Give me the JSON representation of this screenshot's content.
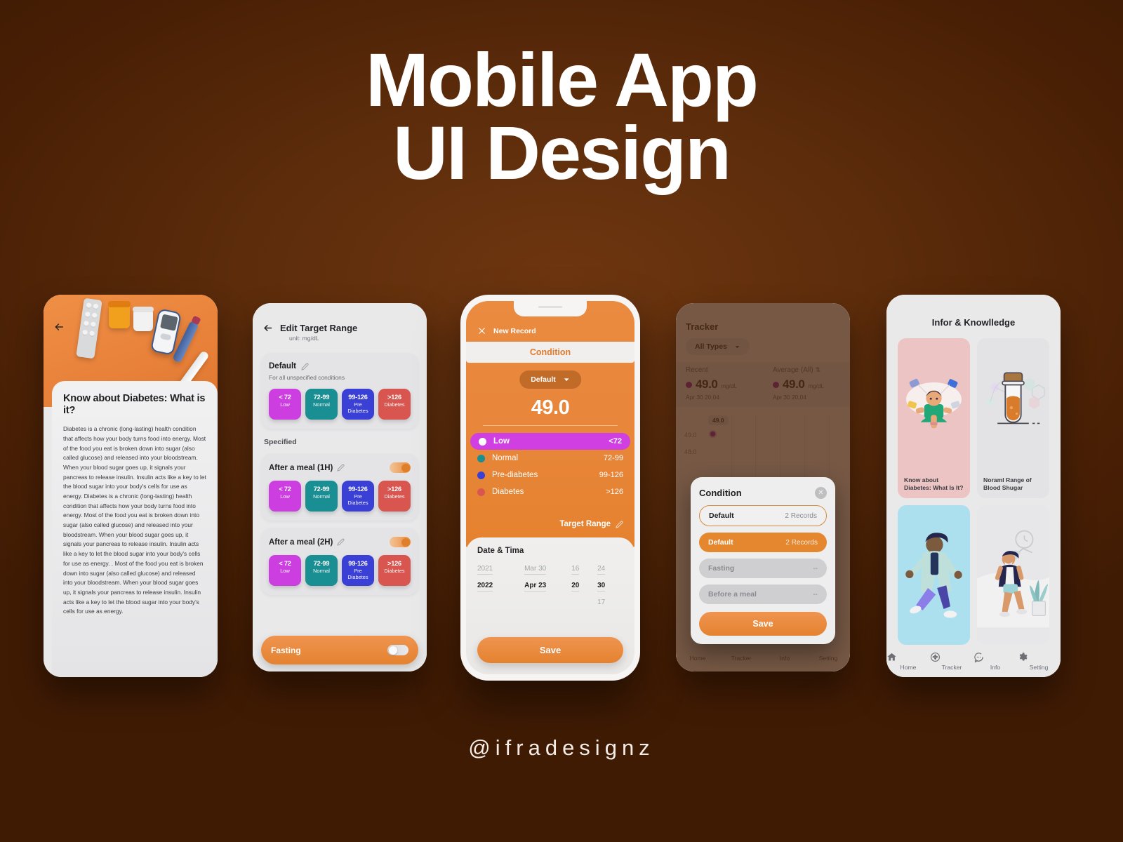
{
  "poster": {
    "title_line1": "Mobile App",
    "title_line2": "UI Design",
    "signature": "@ifradesignz",
    "bg_color": "#4a2005",
    "bg_center_color": "#6e3610",
    "accent_color": "#e4822f"
  },
  "phone1": {
    "back_icon": "back-arrow-icon",
    "article_title": "Know about Diabetes: What is it?",
    "article_body": "Diabetes is a chronic (long-lasting) health condition that affects how your body turns food into energy. Most of the food you eat is broken down into sugar (also called glucose) and released into your bloodstream. When your blood sugar goes up, it signals your pancreas to release insulin. Insulin acts like a key to let the blood sugar into your body's cells for use as energy. Diabetes is a chronic (long-lasting) health condition that affects how your body turns food into energy. Most of the food you eat is broken down into sugar (also called glucose) and released into your bloodstream. When your blood sugar goes up, it signals your pancreas to release insulin. Insulin acts like a key to let the blood sugar into your body's cells for use as energy. . Most of the food you eat is broken down into sugar (also called glucose) and released into your bloodstream. When your blood sugar goes up, it signals your pancreas to release insulin. Insulin acts like a key to let the blood sugar into your body's cells for use as energy."
  },
  "phone2": {
    "back_icon": "back-arrow-icon",
    "title": "Edit Target Range",
    "unit": "unit: mg/dL",
    "default_card": {
      "name": "Default",
      "edit_icon": "pencil-icon",
      "subtitle": "For all unspecified conditions",
      "chips": [
        {
          "value": "< 72",
          "label": "Low",
          "color": "#cc3ee0"
        },
        {
          "value": "72-99",
          "label": "Normal",
          "color": "#1a8f93"
        },
        {
          "value": "99-126",
          "label": "Pre Diabetes",
          "color": "#3a3fd6"
        },
        {
          "value": ">126",
          "label": "Diabetes",
          "color": "#d9554f"
        }
      ]
    },
    "specified_label": "Specified",
    "specified_cards": [
      {
        "name": "After a meal (1H)",
        "toggle_on": true,
        "chips": [
          {
            "value": "< 72",
            "label": "Low",
            "color": "#cc3ee0"
          },
          {
            "value": "72-99",
            "label": "Normal",
            "color": "#1a8f93"
          },
          {
            "value": "99-126",
            "label": "Pre Diabetes",
            "color": "#3a3fd6"
          },
          {
            "value": ">126",
            "label": "Diabetes",
            "color": "#d9554f"
          }
        ]
      },
      {
        "name": "After a meal (2H)",
        "toggle_on": true,
        "chips": [
          {
            "value": "< 72",
            "label": "Low",
            "color": "#cc3ee0"
          },
          {
            "value": "72-99",
            "label": "Normal",
            "color": "#1a8f93"
          },
          {
            "value": "99-126",
            "label": "Pre Diabetes",
            "color": "#3a3fd6"
          },
          {
            "value": ">126",
            "label": "Diabetes",
            "color": "#d9554f"
          }
        ]
      }
    ],
    "fasting": {
      "label": "Fasting",
      "toggle_on": false
    }
  },
  "phone3": {
    "close_icon": "close-x-icon",
    "header_title": "New Record",
    "tab_label": "Condition",
    "condition_selected": "Default",
    "dropdown_icon": "chevron-down-icon",
    "reading_value": "49.0",
    "ranges": [
      {
        "name": "Low",
        "range": "<72",
        "color": "#ffffff",
        "selected": true
      },
      {
        "name": "Normal",
        "range": "72-99",
        "color": "#1a8f93",
        "selected": false
      },
      {
        "name": "Pre-diabetes",
        "range": "99-126",
        "color": "#3a3fd6",
        "selected": false
      },
      {
        "name": "Diabetes",
        "range": ">126",
        "color": "#d9554f",
        "selected": false
      }
    ],
    "target_range_label": "Target Range",
    "target_range_edit_icon": "pencil-icon",
    "datetime_title": "Date & Tima",
    "picker": {
      "year": {
        "prev": "2021",
        "selected": "2022"
      },
      "date": {
        "prev": "Mar 30",
        "selected": "Apr 23"
      },
      "hour": {
        "prev": "16",
        "selected": "20"
      },
      "minute": {
        "prev": "24",
        "selected": "30",
        "next": "17"
      }
    },
    "save_label": "Save"
  },
  "phone4": {
    "title": "Tracker",
    "filter": "All Types",
    "filter_icon": "chevron-down-icon",
    "stats": [
      {
        "header": "Recent",
        "value": "49.0",
        "unit": "mg/dL",
        "timestamp": "Apr 30 20,04"
      },
      {
        "header": "Average (All)",
        "value": "49.0",
        "unit": "mg/dL",
        "timestamp": "Apr 30 20,04",
        "sort_icon": "sort-icon"
      }
    ],
    "chart": {
      "y_labels": [
        "49.0",
        "48.0"
      ],
      "point_tooltip": "49.0"
    },
    "nav": [
      "Home",
      "Tracker",
      "Info",
      "Setting"
    ],
    "modal": {
      "title": "Condition",
      "close_icon": "close-circle-icon",
      "options": [
        {
          "name": "Default",
          "count": "2 Records",
          "style": "outlined"
        },
        {
          "name": "Default",
          "count": "2 Records",
          "style": "filled"
        },
        {
          "name": "Fasting",
          "count": "--",
          "style": "muted"
        },
        {
          "name": "Before a meal",
          "count": "--",
          "style": "muted"
        }
      ],
      "save_label": "Save"
    }
  },
  "phone5": {
    "title": "Infor & Knowlledge",
    "cards": [
      {
        "caption": "Know about Diabetes: What Is It?",
        "bg": "#edc4c4",
        "art": "man-confused"
      },
      {
        "caption": "Noraml Range of Blood Shugar",
        "bg": "#e3e3e5",
        "art": "test-tube"
      },
      {
        "caption": "",
        "bg": "#ace0ef",
        "art": "running-doctor"
      },
      {
        "caption": "",
        "bg": "#e7e7e9",
        "art": "walking-man"
      }
    ],
    "nav": [
      {
        "label": "Home",
        "icon": "home-icon"
      },
      {
        "label": "Tracker",
        "icon": "tracker-icon"
      },
      {
        "label": "Info",
        "icon": "chat-info-icon"
      },
      {
        "label": "Setting",
        "icon": "gear-icon"
      }
    ]
  }
}
